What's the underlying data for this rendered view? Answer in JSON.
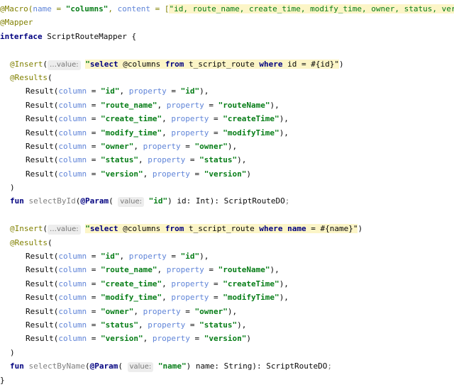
{
  "code": {
    "macro_ann": "@Macro",
    "macro_open": "(",
    "name_param": "name",
    "eq": " = ",
    "macro_name_val": "\"columns\"",
    "comma_sp": ", ",
    "content_param": "content",
    "macro_content_open": " = [",
    "macro_content_val": "\"id, route_name, create_time, modify_time, owner, status, version\"",
    "macro_close": "])",
    "mapper_ann": "@Mapper",
    "interface_kw": "interface",
    "interface_name": " ScriptRouteMapper {",
    "insert_ann": "@Insert",
    "paren_open": "(",
    "hint_value": "…value:",
    "hint_value_plain": "value:",
    "q1_prefix": "\"",
    "q1_select": "select",
    "q1_mid1": " @columns ",
    "q1_from": "from",
    "q1_mid2": " t_script_route ",
    "q1_where": "where",
    "q1_tail": " id = #{id}\"",
    "q2_tail_name": "name",
    "q2_tail": " = #{name}\"",
    "paren_close": ")",
    "results_ann": "@Results",
    "results_open": "(",
    "result_fn": "Result",
    "column_param": "column",
    "property_param": "property",
    "results_close": ")",
    "fun_kw": "fun",
    "select_by_id": " selectById",
    "select_by_name": " selectByName",
    "param_ann": "@Param",
    "id_param_str": "\"id\"",
    "name_param_str": "\"name\"",
    "sig1_tail": ") id: Int): ScriptRouteDO",
    "sig2_tail": ") name: String): ScriptRouteDO",
    "semicolon": ";",
    "close_brace": "}",
    "results": [
      {
        "column": "\"id\"",
        "property": "\"id\"",
        "end": "),"
      },
      {
        "column": "\"route_name\"",
        "property": "\"routeName\"",
        "end": "),"
      },
      {
        "column": "\"create_time\"",
        "property": "\"createTime\"",
        "end": "),"
      },
      {
        "column": "\"modify_time\"",
        "property": "\"modifyTime\"",
        "end": "),"
      },
      {
        "column": "\"owner\"",
        "property": "\"owner\"",
        "end": "),"
      },
      {
        "column": "\"status\"",
        "property": "\"status\"",
        "end": "),"
      },
      {
        "column": "\"version\"",
        "property": "\"version\"",
        "end": ")"
      }
    ]
  },
  "colors": {
    "annotation": "#808000",
    "keyword": "#000080",
    "param_name": "#5f84d8",
    "string": "#067d17",
    "highlight": "#fcf5c7"
  }
}
